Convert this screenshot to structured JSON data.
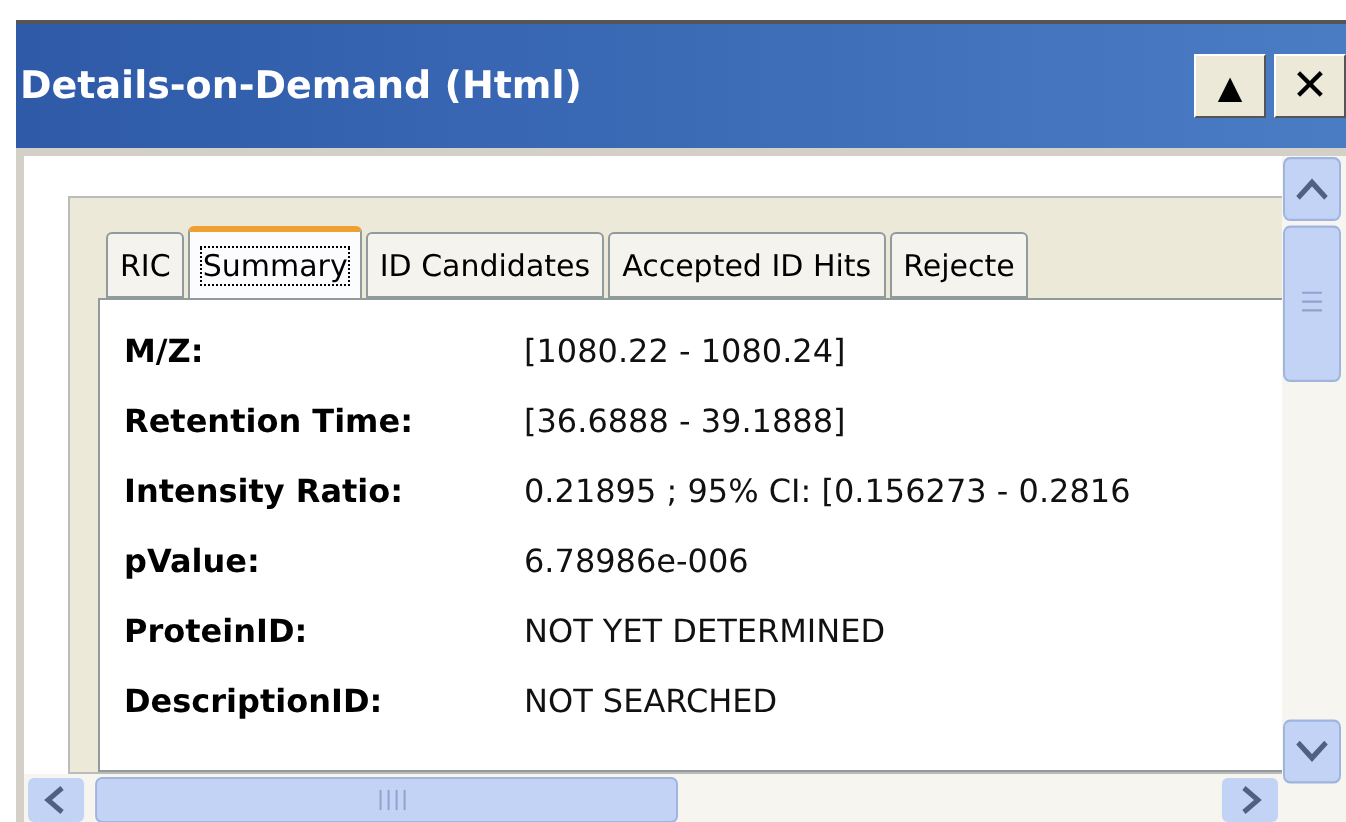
{
  "window": {
    "title": "Details-on-Demand (Html)",
    "buttons": [
      {
        "kind": "up",
        "label": "▲"
      },
      {
        "kind": "close",
        "label": "✕"
      }
    ]
  },
  "tabs": [
    {
      "label": "RIC",
      "selected": false
    },
    {
      "label": "Summary",
      "selected": true
    },
    {
      "label": "ID Candidates",
      "selected": false
    },
    {
      "label": "Accepted ID Hits",
      "selected": false
    },
    {
      "label": "Rejecte",
      "selected": false
    }
  ],
  "summary": [
    {
      "label": "M/Z:",
      "value": "[1080.22 - 1080.24]"
    },
    {
      "label": "Retention Time:",
      "value": "[36.6888 - 39.1888]"
    },
    {
      "label": "Intensity Ratio:",
      "value": "0.21895 ; 95% CI: [0.156273 - 0.2816"
    },
    {
      "label": "pValue:",
      "value": "6.78986e-006"
    },
    {
      "label": "ProteinID:",
      "value": "NOT YET DETERMINED"
    },
    {
      "label": "DescriptionID:",
      "value": "NOT SEARCHED"
    }
  ]
}
